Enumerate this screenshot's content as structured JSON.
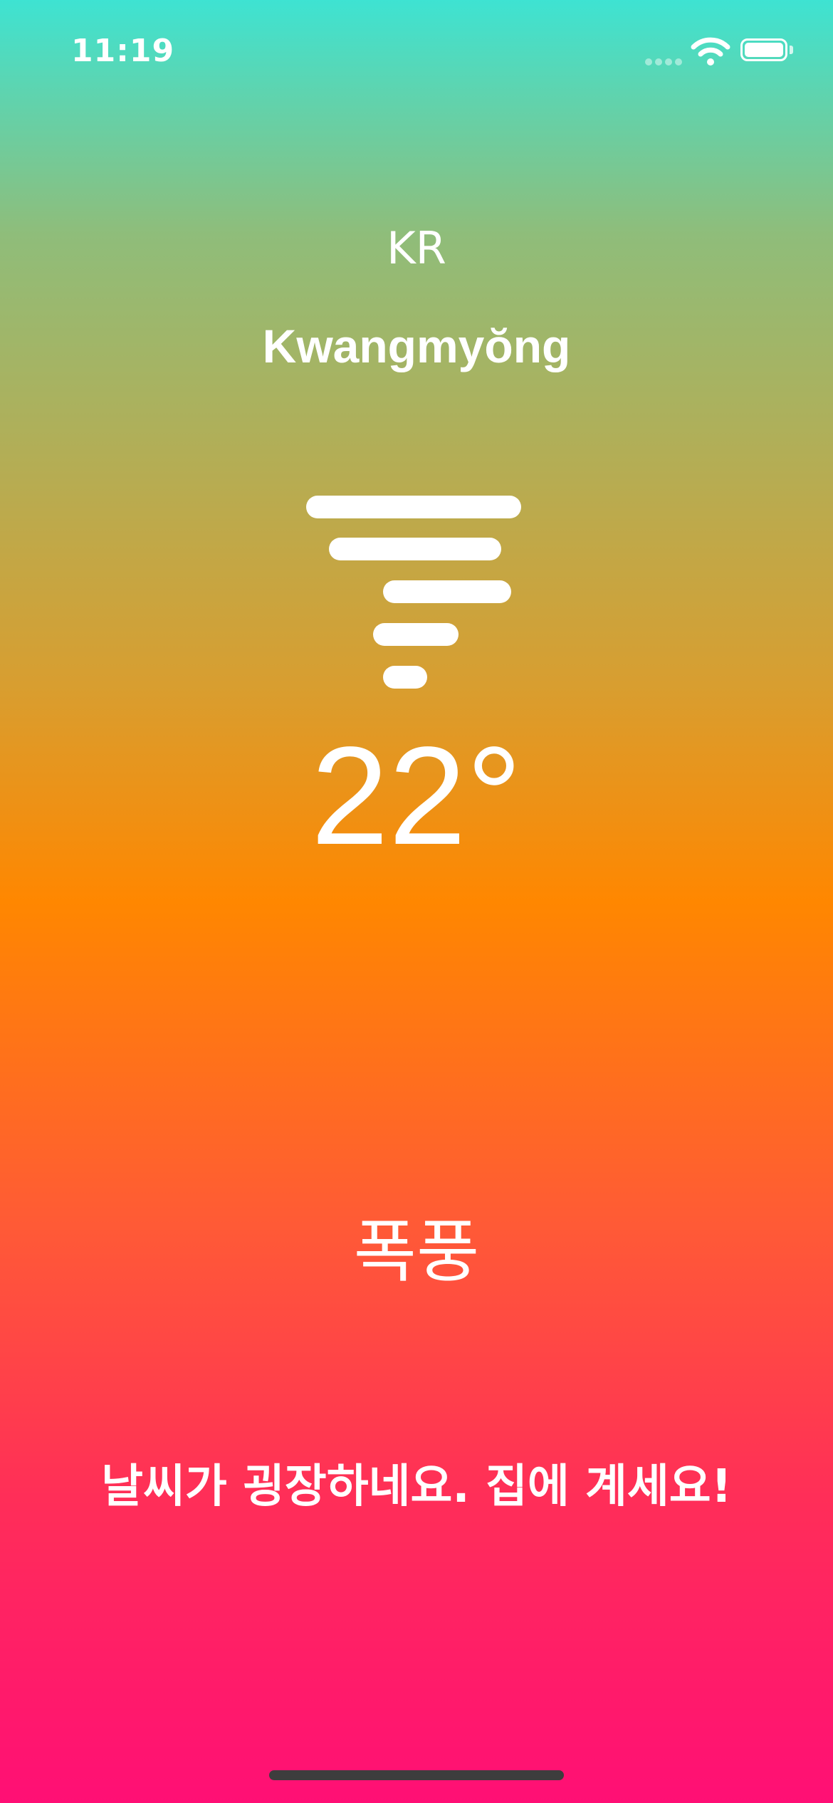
{
  "status_bar": {
    "time": "11:19",
    "icons": [
      "cellular-signal-icon",
      "wifi-icon",
      "battery-icon"
    ]
  },
  "location": {
    "country": "KR",
    "city": "Kwangmyŏng"
  },
  "weather": {
    "icon": "tornado-icon",
    "temperature": "22°",
    "condition": "폭풍",
    "message": "날씨가 굉장하네요. 집에 계세요!"
  },
  "colors": {
    "gradient_top": "#3ee3d2",
    "gradient_middle": "#ff8700",
    "gradient_bottom": "#ff0f75",
    "text": "#ffffff"
  }
}
